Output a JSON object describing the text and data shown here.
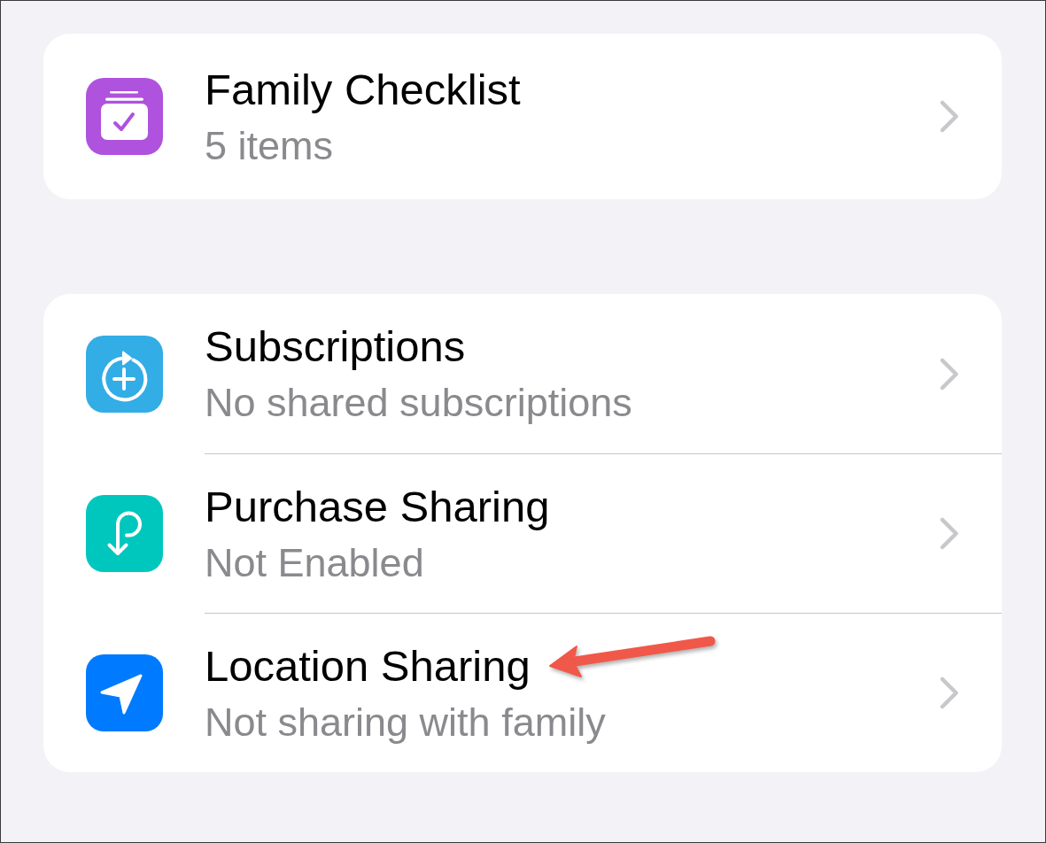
{
  "sections": [
    {
      "rows": [
        {
          "kind": "checklist",
          "title": "Family Checklist",
          "subtitle": "5 items",
          "pointed_out": false
        }
      ]
    },
    {
      "rows": [
        {
          "kind": "subscriptions",
          "title": "Subscriptions",
          "subtitle": "No shared subscriptions",
          "pointed_out": false
        },
        {
          "kind": "purchase",
          "title": "Purchase Sharing",
          "subtitle": "Not Enabled",
          "pointed_out": false
        },
        {
          "kind": "location",
          "title": "Location Sharing",
          "subtitle": "Not sharing with family",
          "pointed_out": true
        }
      ]
    }
  ]
}
